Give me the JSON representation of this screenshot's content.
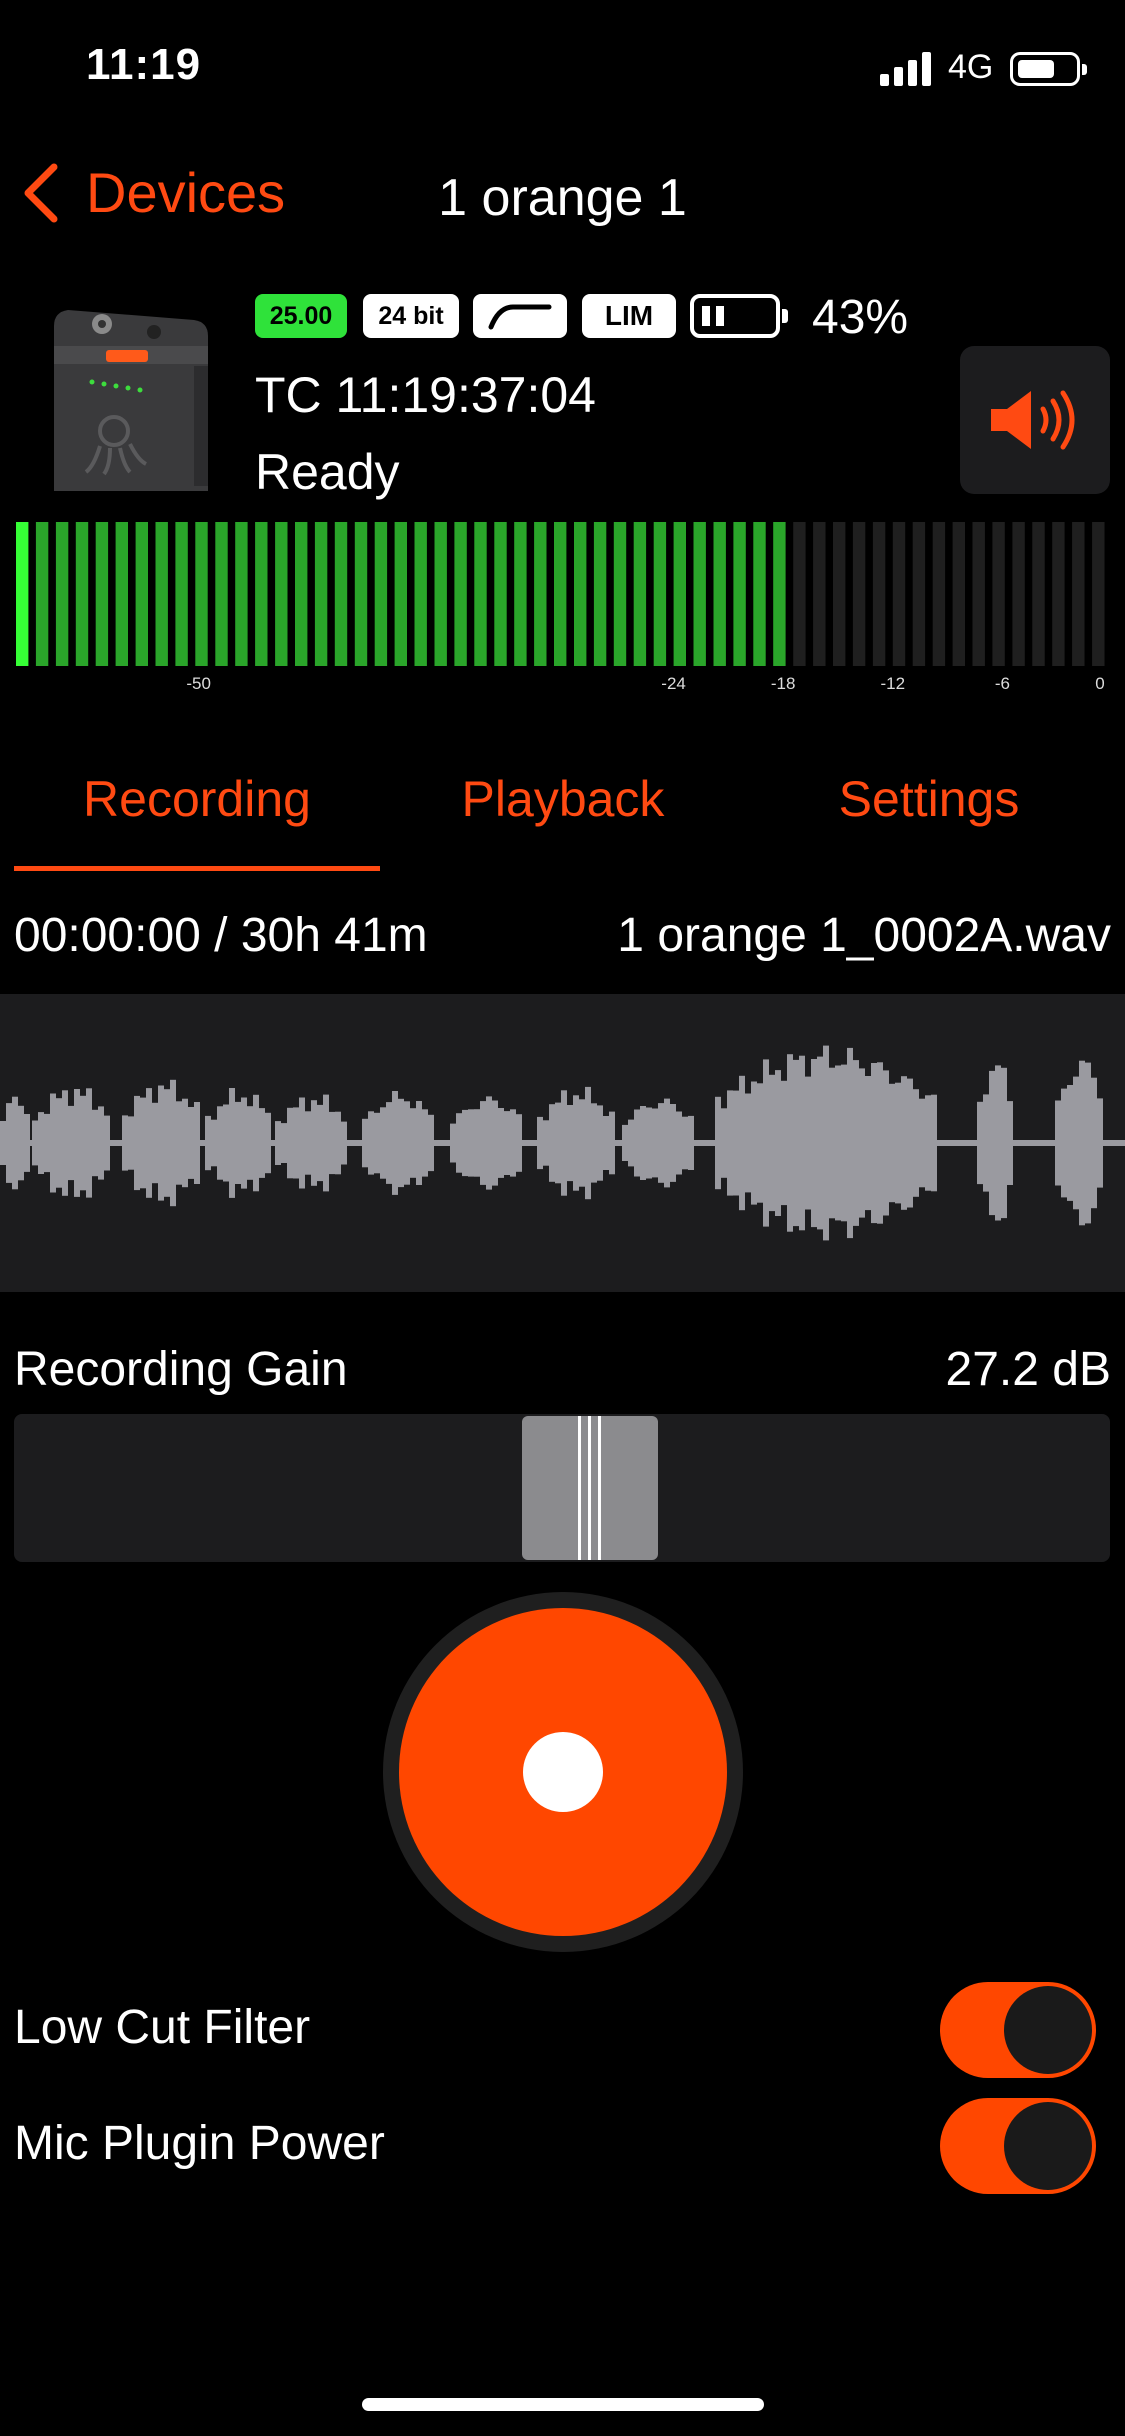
{
  "status_bar": {
    "time": "11:19",
    "network": "4G"
  },
  "nav": {
    "back_label": "Devices",
    "title": "1 orange 1"
  },
  "device": {
    "badges": {
      "fps": "25.00",
      "bit_depth": "24 bit",
      "lim": "LIM"
    },
    "battery_percent": "43%",
    "timecode": "TC 11:19:37:04",
    "state": "Ready"
  },
  "meter": {
    "level_db": -18,
    "range_db": [
      -60,
      0
    ],
    "tick_labels": [
      "-50",
      "-24",
      "-18",
      "-12",
      "-6",
      "0"
    ],
    "colors": {
      "active": "#2aa52a",
      "peak": "#36ff36",
      "inactive": "#1f1f1f"
    }
  },
  "tabs": [
    {
      "label": "Recording",
      "selected": true
    },
    {
      "label": "Playback",
      "selected": false
    },
    {
      "label": "Settings",
      "selected": false
    }
  ],
  "recording": {
    "elapsed": "00:00:00 / 30h 41m",
    "filename": "1 orange 1_0002A.wav"
  },
  "gain": {
    "label": "Recording Gain",
    "value": "27.2 dB",
    "fraction": 0.5
  },
  "toggles": [
    {
      "label": "Low Cut Filter",
      "on": true
    },
    {
      "label": "Mic Plugin Power",
      "on": true
    }
  ],
  "icons": {
    "back": "chevron-left-icon",
    "speaker": "speaker-icon",
    "record": "record-icon"
  },
  "colors": {
    "accent": "#ff4a12",
    "record": "#ff4700",
    "fps_badge": "#2fe23a"
  }
}
